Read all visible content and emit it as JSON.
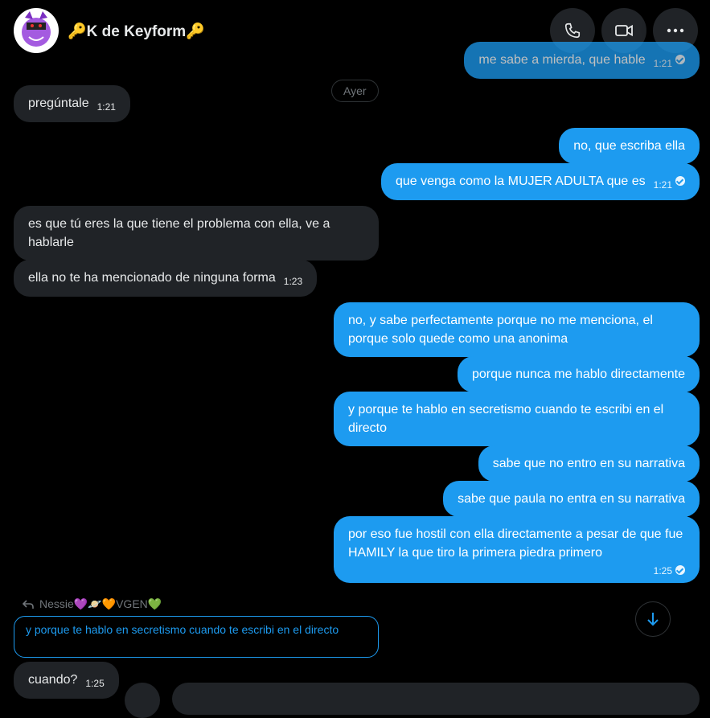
{
  "header": {
    "name": "🔑K de Keyform🔑",
    "call_icon": "phone-icon",
    "video_icon": "video-icon",
    "more_icon": "more-icon"
  },
  "date_separator": "Ayer",
  "messages": [
    {
      "dir": "out",
      "text": "me sabe a mierda, que hable",
      "time": "1:21",
      "read": true
    },
    {
      "dir": "in",
      "text": "pregúntale",
      "time": "1:21"
    },
    {
      "dir": "out",
      "text": "no, que escriba ella",
      "time": ""
    },
    {
      "dir": "out",
      "text": "que venga como la MUJER ADULTA que es",
      "time": "1:21",
      "read": true
    },
    {
      "dir": "in",
      "text": "es que tú eres la que tiene el problema con ella, ve a hablarle",
      "time": ""
    },
    {
      "dir": "in",
      "text": "ella no te ha mencionado de ninguna forma",
      "time": "1:23"
    },
    {
      "dir": "out",
      "text": "no, y sabe perfectamente porque no me menciona, el porque solo quede como una anonima",
      "time": ""
    },
    {
      "dir": "out",
      "text": "porque nunca me hablo directamente",
      "time": ""
    },
    {
      "dir": "out",
      "text": "y porque te hablo en secretismo cuando te escribi en el directo",
      "time": ""
    },
    {
      "dir": "out",
      "text": "sabe que no entro en su narrativa",
      "time": ""
    },
    {
      "dir": "out",
      "text": "sabe que paula no entra en su narrativa",
      "time": ""
    },
    {
      "dir": "out",
      "text": "por eso fue hostil con ella directamente a pesar de que fue HAMILY la que tiro la primera piedra primero",
      "time": "1:25",
      "read": true
    }
  ],
  "reply": {
    "to": "Nessie💜🪐🧡VGEN💚",
    "quoted": "y porque te hablo en secretismo cuando te escribi en el directo",
    "text": "cuando?",
    "time": "1:25"
  },
  "colors": {
    "accent": "#1d9bf0",
    "incoming": "#202327",
    "background": "#000000"
  }
}
